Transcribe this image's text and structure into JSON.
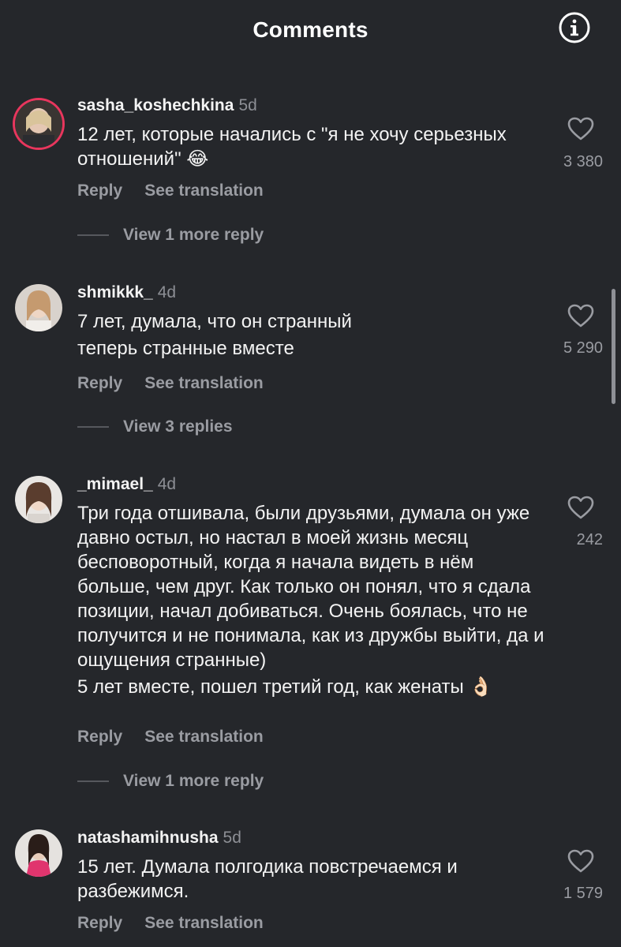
{
  "header": {
    "title": "Comments",
    "info_icon": "info-circle-icon"
  },
  "comments": [
    {
      "username": "sasha_koshechkina",
      "time": "5d",
      "lines": [
        "12 лет, которые начались с \"я не хочу серьезных отношений\" 😂"
      ],
      "likes": "3 380",
      "reply": "Reply",
      "translate": "See translation",
      "view_replies": "View 1 more reply"
    },
    {
      "username": "shmikkk_",
      "time": "4d",
      "lines": [
        "7 лет, думала, что он странный",
        "теперь странные вместе"
      ],
      "likes": "5 290",
      "reply": "Reply",
      "translate": "See translation",
      "view_replies": "View 3 replies"
    },
    {
      "username": "_mimael_",
      "time": "4d",
      "lines": [
        "Три года отшивала, были друзьями, думала он уже давно остыл, но настал в моей жизнь месяц бесповоротный, когда я начала видеть в нём больше, чем друг. Как только он понял, что я сдала позиции, начал добиваться. Очень боялась, что не получится и не понимала, как из дружбы выйти, да и ощущения странные)",
        "5 лет вместе, пошел третий год, как женаты 👌🏻"
      ],
      "likes": "242",
      "reply": "Reply",
      "translate": "See translation",
      "view_replies": "View 1 more reply"
    },
    {
      "username": "natashamihnusha",
      "time": "5d",
      "lines": [
        "15 лет. Думала полгодика повстречаемся и разбежимся."
      ],
      "likes": "1 579",
      "reply": "Reply",
      "translate": "See translation"
    }
  ]
}
